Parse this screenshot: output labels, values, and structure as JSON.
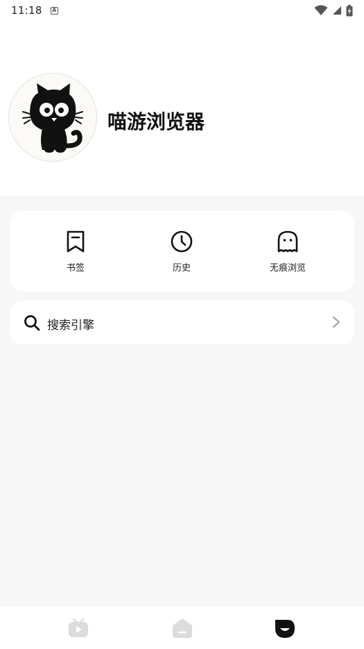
{
  "status_bar": {
    "time": "11:18",
    "notification_icon": "a-letter-icon",
    "icons": [
      "wifi-icon",
      "signal-icon",
      "battery-charging-icon"
    ]
  },
  "profile": {
    "app_name": "喵游浏览器",
    "avatar": "black-cat-icon"
  },
  "quick_actions": [
    {
      "label": "书签",
      "icon": "bookmark-icon"
    },
    {
      "label": "历史",
      "icon": "clock-icon"
    },
    {
      "label": "无痕浏览",
      "icon": "ghost-icon"
    }
  ],
  "settings": {
    "search_engine_label": "搜索引擎",
    "search_icon": "search-icon",
    "chevron_icon": "chevron-right-icon"
  },
  "bottom_nav": {
    "items": [
      {
        "icon": "video-tv-icon",
        "active": false
      },
      {
        "icon": "home-icon",
        "active": false
      },
      {
        "icon": "profile-face-icon",
        "active": true
      }
    ]
  },
  "colors": {
    "background": "#f7f7f7",
    "card": "#ffffff",
    "text": "#111111",
    "inactive_nav": "#dcdcdc",
    "active_nav": "#111111"
  }
}
